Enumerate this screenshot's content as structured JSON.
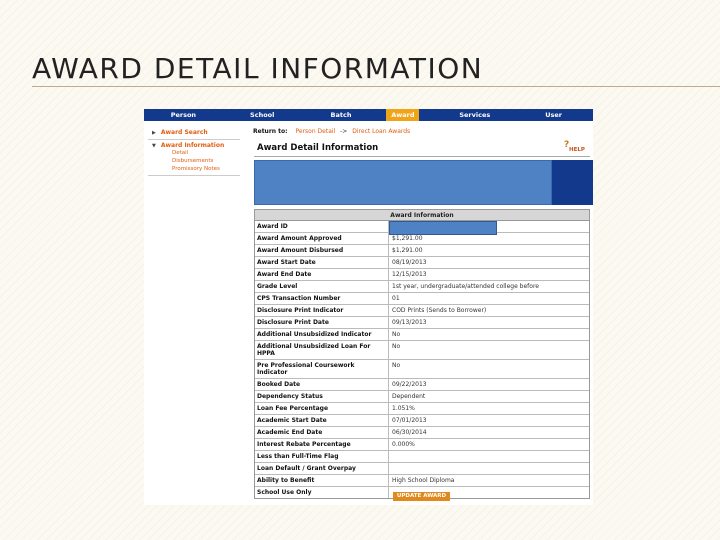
{
  "slide": {
    "title": "AWARD DETAIL INFORMATION"
  },
  "nav": [
    "Person",
    "School",
    "Batch",
    "Award",
    "Services",
    "User"
  ],
  "nav_active": "Award",
  "sidebar": {
    "award_search": "Award Search",
    "award_information": "Award Information",
    "sub_items": [
      "Detail",
      "Disbursements",
      "Promissory Notes"
    ]
  },
  "return_row": {
    "label": "Return to:",
    "link1": "Person Detail",
    "separator": "->",
    "link2": "Direct Loan Awards"
  },
  "panel": {
    "title": "Award Detail Information",
    "help": "HELP"
  },
  "table": {
    "header": "Award Information",
    "rows": [
      {
        "label": "Award ID",
        "value": ""
      },
      {
        "label": "Award Amount Approved",
        "value": "$1,291.00"
      },
      {
        "label": "Award Amount Disbursed",
        "value": "$1,291.00"
      },
      {
        "label": "Award Start Date",
        "value": "08/19/2013"
      },
      {
        "label": "Award End Date",
        "value": "12/15/2013"
      },
      {
        "label": "Grade Level",
        "value": "1st year, undergraduate/attended college before"
      },
      {
        "label": "CPS Transaction Number",
        "value": "01"
      },
      {
        "label": "Disclosure Print Indicator",
        "value": "COD Prints (Sends to Borrower)"
      },
      {
        "label": "Disclosure Print Date",
        "value": "09/13/2013"
      },
      {
        "label": "Additional Unsubsidized Indicator",
        "value": "No"
      },
      {
        "label": "Additional Unsubsidized Loan For HPPA",
        "value": "No"
      },
      {
        "label": "Pre Professional Coursework Indicator",
        "value": "No"
      },
      {
        "label": "Booked Date",
        "value": "09/22/2013"
      },
      {
        "label": "Dependency Status",
        "value": "Dependent"
      },
      {
        "label": "Loan Fee Percentage",
        "value": "1.051%"
      },
      {
        "label": "Academic Start Date",
        "value": "07/01/2013"
      },
      {
        "label": "Academic End Date",
        "value": "06/30/2014"
      },
      {
        "label": "Interest Rebate Percentage",
        "value": "0.000%"
      },
      {
        "label": "Less than Full-Time Flag",
        "value": ""
      },
      {
        "label": "Loan Default / Grant Overpay",
        "value": ""
      },
      {
        "label": "Ability to Benefit",
        "value": "High School Diploma"
      },
      {
        "label": "School Use Only",
        "value": ""
      }
    ]
  },
  "update_button": "UPDATE AWARD"
}
